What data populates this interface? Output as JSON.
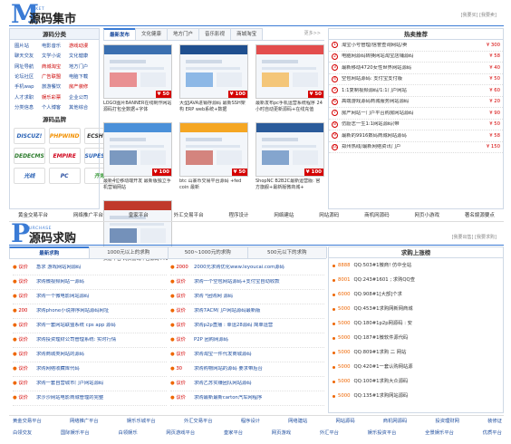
{
  "header1": {
    "logo_letter": "M",
    "logo_small": "ARKET",
    "title": "源码集市",
    "right_links": "[我要买] [我要卖]"
  },
  "categories": {
    "title": "源码分类",
    "items": [
      {
        "label": "图片站",
        "color": "#1a4a9c"
      },
      {
        "label": "电影音乐",
        "color": "#1a4a9c"
      },
      {
        "label": "游戏动漫",
        "color": "#c00"
      },
      {
        "label": "聊天交友",
        "color": "#1a4a9c"
      },
      {
        "label": "文学小说",
        "color": "#1a4a9c"
      },
      {
        "label": "文化健康",
        "color": "#1a4a9c"
      },
      {
        "label": "网址导航",
        "color": "#1a4a9c"
      },
      {
        "label": "商城淘宝",
        "color": "#c00"
      },
      {
        "label": "地方门户",
        "color": "#1a4a9c"
      },
      {
        "label": "论坛社区",
        "color": "#1a4a9c"
      },
      {
        "label": "广告联盟",
        "color": "#c00"
      },
      {
        "label": "电脑下载",
        "color": "#1a4a9c"
      },
      {
        "label": "手机wap",
        "color": "#1a4a9c"
      },
      {
        "label": "旅游餐饮",
        "color": "#1a4a9c"
      },
      {
        "label": "房产装修",
        "color": "#c00"
      },
      {
        "label": "人才求职",
        "color": "#1a4a9c"
      },
      {
        "label": "娱乐彩票",
        "color": "#c00"
      },
      {
        "label": "企业公司",
        "color": "#1a4a9c"
      },
      {
        "label": "分类信息",
        "color": "#1a4a9c"
      },
      {
        "label": "个人博客",
        "color": "#1a4a9c"
      },
      {
        "label": "其他综合",
        "color": "#1a4a9c"
      }
    ]
  },
  "brands": {
    "title": "源码品牌",
    "items": [
      {
        "label": "DISCUZ!",
        "color": "#2a62b5"
      },
      {
        "label": "PHPWIND",
        "color": "#f29000"
      },
      {
        "label": "ECSHOP",
        "color": "#333"
      },
      {
        "label": "DEDECMS",
        "color": "#2a7a2a"
      },
      {
        "label": "EMPIRE",
        "color": "#d0021b"
      },
      {
        "label": "SUPESITE",
        "color": "#2a62b5"
      },
      {
        "label": "光线",
        "color": "#2a62b5"
      },
      {
        "label": "PC",
        "color": "#2a4fa0"
      },
      {
        "label": "齐博",
        "color": "#3a9a3a"
      }
    ]
  },
  "tabs": {
    "items": [
      "最新发布",
      "文化健康",
      "地方门户",
      "音乐影视",
      "商城淘宝"
    ],
    "more": "更多>>"
  },
  "products": [
    {
      "title": "LOGO图片BANNER在线制作网站源码打包全数据+字体",
      "price": "¥ 50"
    },
    {
      "title": "大型JAVA进销存源码 最新SSH架构 ERP web系统+数据",
      "price": "¥ 100"
    },
    {
      "title": "最新发布pc手机运营系统程序 24小时自动更新源码+在线充值",
      "price": "¥ 50"
    },
    {
      "title": "最新4位移动端开发 最新版独立手机营销网站",
      "price": "¥ 100"
    },
    {
      "title": "btc 山寨币交易平台源码 +fed coin 最新",
      "price": "¥ 50"
    },
    {
      "title": "ShopNC B2B2C最新运营版: 官方旗舰+最新版微商城+",
      "price": "¥ 100"
    },
    {
      "title": "页游平台 网页游戏平台源码 PHP",
      "price": "¥ 50"
    }
  ],
  "hot": {
    "title": "热卖推荐",
    "items": [
      {
        "text": "淘宝小号管理/信誉查询网站/卖",
        "price": "¥ 300"
      },
      {
        "text": "电脑网源码转换网站淘宝店铺源码",
        "price": "¥ 58"
      },
      {
        "text": "最新移动4720女性世界网站源码",
        "price": "¥ 40"
      },
      {
        "text": "空包网站源码: 支付宝支付版",
        "price": "¥ 50"
      },
      {
        "text": "1:1复制视频源码/1:1门户网站",
        "price": "¥ 60"
      },
      {
        "text": "高端游戏源码商城服务网站源码",
        "price": "¥ 20"
      },
      {
        "text": "房产网站一门户平台购房网站源码",
        "price": "¥ 90"
      },
      {
        "text": "仿励志一生1:1网站源码(带",
        "price": "¥ 50"
      },
      {
        "text": "最新的9916数码商城网站源码",
        "price": "¥ 58"
      },
      {
        "text": "郑州热线/最新网络资讯门户",
        "price": "¥ 150"
      }
    ]
  },
  "linkbar1": [
    "黄金交易平台",
    "网络推广平台",
    "皇家平台",
    "外汇交易平台",
    "程序设计",
    "网络建站",
    "网站源码",
    "商机网源码",
    "网页小游戏",
    "著名娱源要点"
  ],
  "header2": {
    "logo_letter": "P",
    "logo_small": "URCHASE",
    "title": "源码求购",
    "right_links": "[我要出售] [我要求购]"
  },
  "want_tabs": [
    "最新求购",
    "1000元以上的求购",
    "500~1000元的求购",
    "500元以下的求购"
  ],
  "want_left": [
    {
      "tag": "议价",
      "text": "急求 游戏网站网源码"
    },
    {
      "tag": "议价",
      "text": "求购微视频网站一源码"
    },
    {
      "tag": "议价",
      "text": "求购一个微电影网站源码"
    },
    {
      "tag": "200",
      "text": "求购phone小说排序网站源码网址"
    },
    {
      "tag": "议价",
      "text": "求购一套网站联盟系统 cps app 源码"
    },
    {
      "tag": "议价",
      "text": "求购投资理财公司管理系统: 实时行情"
    },
    {
      "tag": "议价",
      "text": "求购商城类网站的源码"
    },
    {
      "tag": "议价",
      "text": "求购网络收藏库代码"
    },
    {
      "tag": "议价",
      "text": "求购一套自营城市门户网站源码"
    },
    {
      "tag": "议价",
      "text": "求沙沙网站电影商城管理的完整"
    }
  ],
  "want_mid": [
    {
      "tag": "2000",
      "text": "2000元求购优化www.leyoucai.com源码"
    },
    {
      "tag": "议价",
      "text": "求购一个空包网站源码+支付宝自动收款"
    },
    {
      "tag": "议价",
      "text": "求购 *团购网 源码"
    },
    {
      "tag": "议价",
      "text": "求购7ACM门户网站源码最新版"
    },
    {
      "tag": "议价",
      "text": "求购p2p直播 : 幸运28源码 简单运营"
    },
    {
      "tag": "议价",
      "text": "P2P 团购网源码"
    },
    {
      "tag": "议价",
      "text": "求购淘宝一件代发商城源码"
    },
    {
      "tag": "30",
      "text": "求购购物网站的源码 要求带后台"
    },
    {
      "tag": "议价",
      "text": "求购乙苏实赚团队网站源码"
    },
    {
      "tag": "议价",
      "text": "求购最新最新carton汽车网程序"
    }
  ],
  "rank": {
    "title": "求购上涨榜",
    "items": [
      {
        "price": "8888",
        "text": "QQ:503#1微商! 仿中全站"
      },
      {
        "price": "8001",
        "text": "QQ:243#1601 ; 求购QQ查"
      },
      {
        "price": "6000",
        "text": "QQ:908#1[大部]个求"
      },
      {
        "price": "5000",
        "text": "QQ:453#1求购网新网商城"
      },
      {
        "price": "5000",
        "text": "QQ:180#1p2p网源码 : 安"
      },
      {
        "price": "5000",
        "text": "QQ:187#1微软件源代码"
      },
      {
        "price": "5000",
        "text": "QQ:809#1求购 二 网站"
      },
      {
        "price": "5000",
        "text": "QQ:420#1一套认购网站源"
      },
      {
        "price": "5000",
        "text": "QQ:100#1求购大众源码"
      },
      {
        "price": "5000",
        "text": "QQ:135#1求购网站源码"
      }
    ]
  },
  "footer_row1": [
    "黄金交易平台",
    "网络推广平台",
    "娱乐乐城平台",
    "外汇交易平台",
    "程序设计",
    "网络建站",
    "网站源码",
    "商机网源码",
    "投资理财网",
    "装修证"
  ],
  "footer_row2": [
    "白领交友",
    "国际娱乐平台",
    "白领娱乐",
    "网页游戏平台",
    "皇家平台",
    "网页游戏",
    "外汇平台",
    "娱乐投资平台",
    "全景娱乐平台",
    "优质平台"
  ]
}
